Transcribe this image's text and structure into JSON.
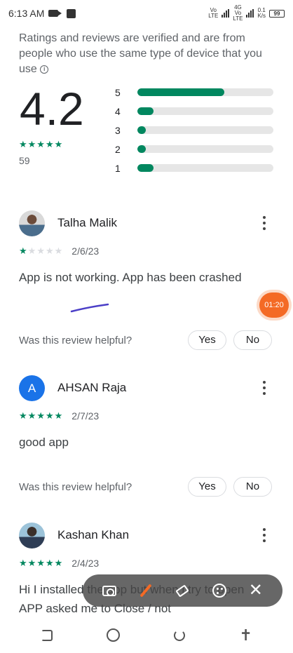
{
  "status_bar": {
    "time": "6:13 AM",
    "network_1": "Vo\nLTE",
    "network_2": "4G\nVo\nLTE",
    "speed": "0.1\nK/s",
    "battery": "99"
  },
  "ratings": {
    "note": "Ratings and reviews are verified and are from people who use the same type of device that you use",
    "average": "4.2",
    "average_stars": "★★★★★",
    "count": "59",
    "histogram": [
      {
        "label": "5",
        "fraction": 0.64
      },
      {
        "label": "4",
        "fraction": 0.12
      },
      {
        "label": "3",
        "fraction": 0.06
      },
      {
        "label": "2",
        "fraction": 0.06
      },
      {
        "label": "1",
        "fraction": 0.12
      }
    ]
  },
  "reviews": [
    {
      "name": "Talha Malik",
      "rating": 1,
      "date": "2/6/23",
      "text": "App is not working. App has been crashed",
      "helpful_question": "Was this review helpful?",
      "yes_label": "Yes",
      "no_label": "No"
    },
    {
      "name": "AHSAN Raja",
      "avatar_letter": "A",
      "rating": 5,
      "date": "2/7/23",
      "text": "good app",
      "helpful_question": "Was this review helpful?",
      "yes_label": "Yes",
      "no_label": "No"
    },
    {
      "name": "Kashan Khan",
      "rating": 5,
      "date": "2/4/23",
      "text": "Hi I installed the app but when i try to open APP asked me to Close / not"
    }
  ],
  "overlay": {
    "timer": "01:20"
  },
  "colors": {
    "accent": "#01875f",
    "timer": "#f46a25",
    "avatar_letter_bg": "#1a73e8"
  }
}
